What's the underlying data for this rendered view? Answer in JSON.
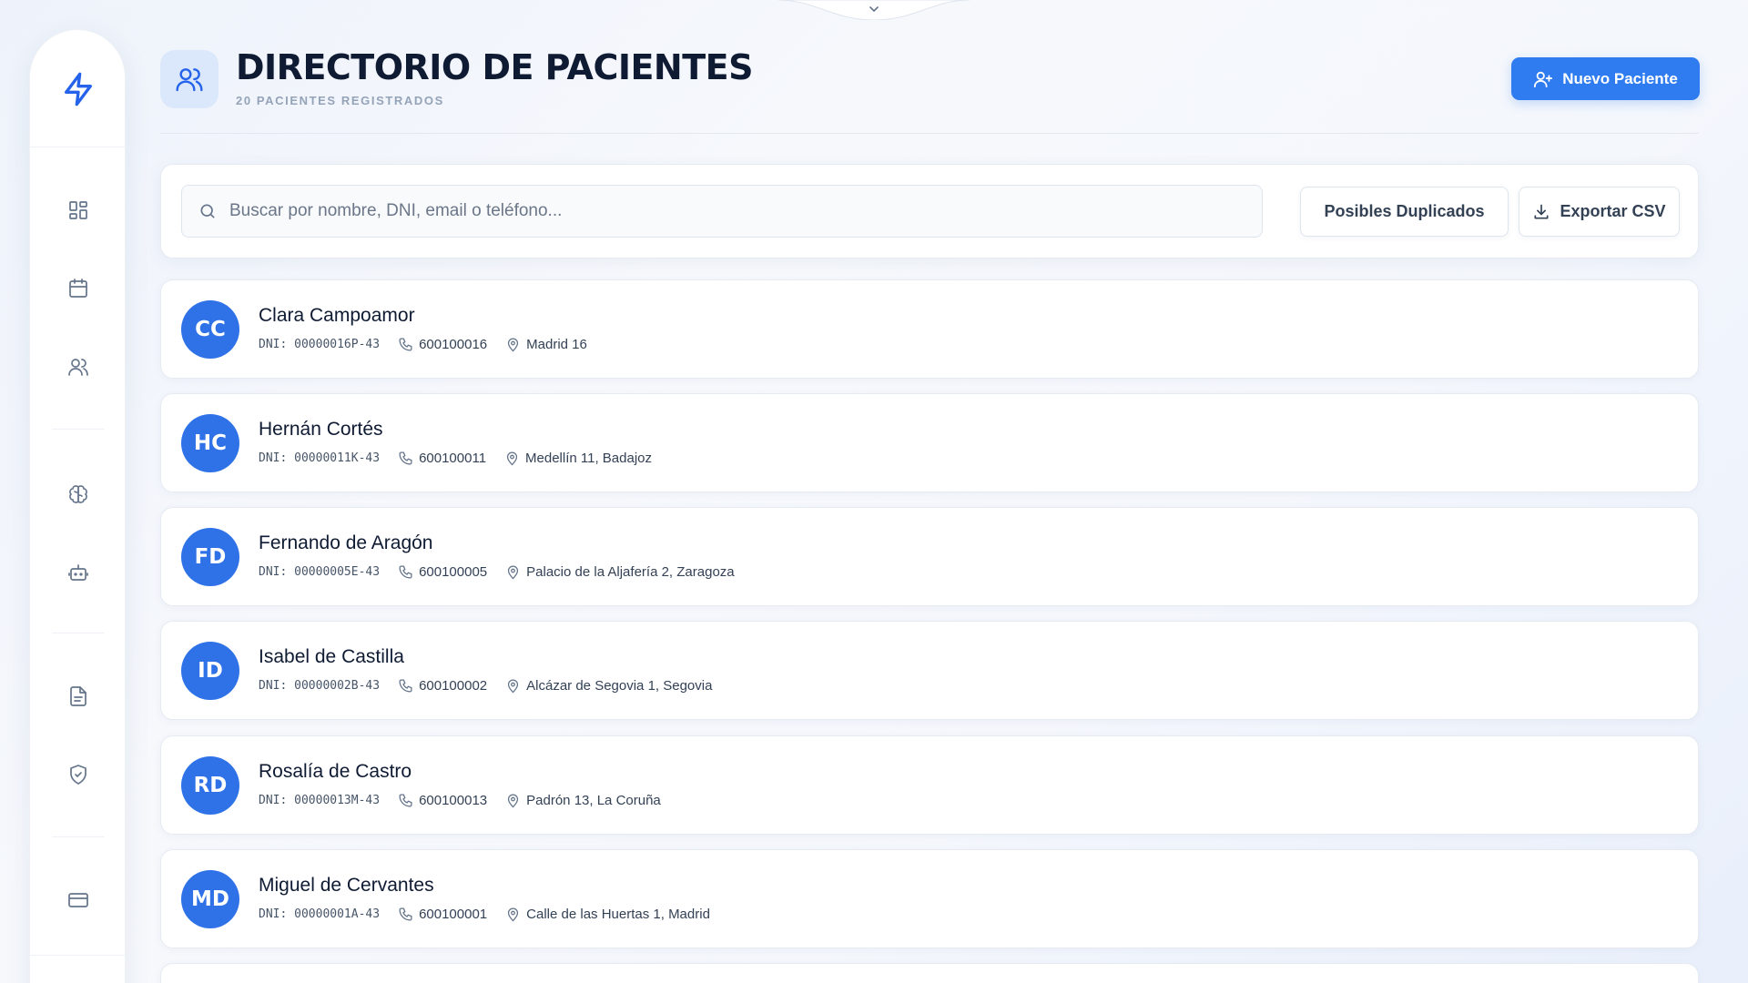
{
  "header": {
    "title": "DIRECTORIO DE PACIENTES",
    "subtitle": "20 PACIENTES REGISTRADOS",
    "new_button_label": "Nuevo Paciente"
  },
  "search": {
    "placeholder": "Buscar por nombre, DNI, email o teléfono...",
    "value": ""
  },
  "toolbar": {
    "duplicates_label": "Posibles Duplicados",
    "export_label": "Exportar CSV"
  },
  "sidebar": {
    "items": [
      {
        "icon": "lightning-logo-icon"
      },
      {
        "icon": "dashboard-grid-icon"
      },
      {
        "icon": "calendar-icon"
      },
      {
        "icon": "users-icon"
      },
      {
        "icon": "brain-icon"
      },
      {
        "icon": "bot-icon"
      },
      {
        "icon": "document-icon"
      },
      {
        "icon": "shield-check-icon"
      },
      {
        "icon": "credit-card-icon"
      }
    ]
  },
  "patients": [
    {
      "initials": "CC",
      "name": "Clara Campoamor",
      "dni": "DNI: 00000016P-43",
      "phone": "600100016",
      "address": "Madrid 16"
    },
    {
      "initials": "HC",
      "name": "Hernán Cortés",
      "dni": "DNI: 00000011K-43",
      "phone": "600100011",
      "address": "Medellín 11, Badajoz"
    },
    {
      "initials": "FD",
      "name": "Fernando de Aragón",
      "dni": "DNI: 00000005E-43",
      "phone": "600100005",
      "address": "Palacio de la Aljafería 2, Zaragoza"
    },
    {
      "initials": "ID",
      "name": "Isabel de Castilla",
      "dni": "DNI: 00000002B-43",
      "phone": "600100002",
      "address": "Alcázar de Segovia 1, Segovia"
    },
    {
      "initials": "RD",
      "name": "Rosalía de Castro",
      "dni": "DNI: 00000013M-43",
      "phone": "600100013",
      "address": "Padrón 13, La Coruña"
    },
    {
      "initials": "MD",
      "name": "Miguel de Cervantes",
      "dni": "DNI: 00000001A-43",
      "phone": "600100001",
      "address": "Calle de las Huertas 1, Madrid"
    }
  ],
  "colors": {
    "accent": "#2f7bf0",
    "avatar": "#2f72e8",
    "title": "#0f1b33",
    "icon_muted": "#64748b"
  }
}
